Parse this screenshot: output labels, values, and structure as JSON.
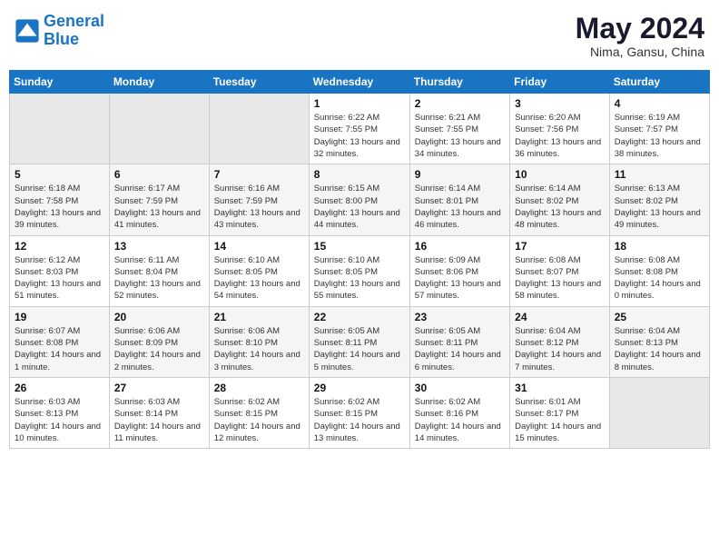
{
  "header": {
    "logo_line1": "General",
    "logo_line2": "Blue",
    "month_year": "May 2024",
    "location": "Nima, Gansu, China"
  },
  "days_of_week": [
    "Sunday",
    "Monday",
    "Tuesday",
    "Wednesday",
    "Thursday",
    "Friday",
    "Saturday"
  ],
  "weeks": [
    [
      {
        "day": "",
        "empty": true
      },
      {
        "day": "",
        "empty": true
      },
      {
        "day": "",
        "empty": true
      },
      {
        "day": "1",
        "sunrise": "6:22 AM",
        "sunset": "7:55 PM",
        "daylight": "13 hours and 32 minutes."
      },
      {
        "day": "2",
        "sunrise": "6:21 AM",
        "sunset": "7:55 PM",
        "daylight": "13 hours and 34 minutes."
      },
      {
        "day": "3",
        "sunrise": "6:20 AM",
        "sunset": "7:56 PM",
        "daylight": "13 hours and 36 minutes."
      },
      {
        "day": "4",
        "sunrise": "6:19 AM",
        "sunset": "7:57 PM",
        "daylight": "13 hours and 38 minutes."
      }
    ],
    [
      {
        "day": "5",
        "sunrise": "6:18 AM",
        "sunset": "7:58 PM",
        "daylight": "13 hours and 39 minutes."
      },
      {
        "day": "6",
        "sunrise": "6:17 AM",
        "sunset": "7:59 PM",
        "daylight": "13 hours and 41 minutes."
      },
      {
        "day": "7",
        "sunrise": "6:16 AM",
        "sunset": "7:59 PM",
        "daylight": "13 hours and 43 minutes."
      },
      {
        "day": "8",
        "sunrise": "6:15 AM",
        "sunset": "8:00 PM",
        "daylight": "13 hours and 44 minutes."
      },
      {
        "day": "9",
        "sunrise": "6:14 AM",
        "sunset": "8:01 PM",
        "daylight": "13 hours and 46 minutes."
      },
      {
        "day": "10",
        "sunrise": "6:14 AM",
        "sunset": "8:02 PM",
        "daylight": "13 hours and 48 minutes."
      },
      {
        "day": "11",
        "sunrise": "6:13 AM",
        "sunset": "8:02 PM",
        "daylight": "13 hours and 49 minutes."
      }
    ],
    [
      {
        "day": "12",
        "sunrise": "6:12 AM",
        "sunset": "8:03 PM",
        "daylight": "13 hours and 51 minutes."
      },
      {
        "day": "13",
        "sunrise": "6:11 AM",
        "sunset": "8:04 PM",
        "daylight": "13 hours and 52 minutes."
      },
      {
        "day": "14",
        "sunrise": "6:10 AM",
        "sunset": "8:05 PM",
        "daylight": "13 hours and 54 minutes."
      },
      {
        "day": "15",
        "sunrise": "6:10 AM",
        "sunset": "8:05 PM",
        "daylight": "13 hours and 55 minutes."
      },
      {
        "day": "16",
        "sunrise": "6:09 AM",
        "sunset": "8:06 PM",
        "daylight": "13 hours and 57 minutes."
      },
      {
        "day": "17",
        "sunrise": "6:08 AM",
        "sunset": "8:07 PM",
        "daylight": "13 hours and 58 minutes."
      },
      {
        "day": "18",
        "sunrise": "6:08 AM",
        "sunset": "8:08 PM",
        "daylight": "14 hours and 0 minutes."
      }
    ],
    [
      {
        "day": "19",
        "sunrise": "6:07 AM",
        "sunset": "8:08 PM",
        "daylight": "14 hours and 1 minute."
      },
      {
        "day": "20",
        "sunrise": "6:06 AM",
        "sunset": "8:09 PM",
        "daylight": "14 hours and 2 minutes."
      },
      {
        "day": "21",
        "sunrise": "6:06 AM",
        "sunset": "8:10 PM",
        "daylight": "14 hours and 3 minutes."
      },
      {
        "day": "22",
        "sunrise": "6:05 AM",
        "sunset": "8:11 PM",
        "daylight": "14 hours and 5 minutes."
      },
      {
        "day": "23",
        "sunrise": "6:05 AM",
        "sunset": "8:11 PM",
        "daylight": "14 hours and 6 minutes."
      },
      {
        "day": "24",
        "sunrise": "6:04 AM",
        "sunset": "8:12 PM",
        "daylight": "14 hours and 7 minutes."
      },
      {
        "day": "25",
        "sunrise": "6:04 AM",
        "sunset": "8:13 PM",
        "daylight": "14 hours and 8 minutes."
      }
    ],
    [
      {
        "day": "26",
        "sunrise": "6:03 AM",
        "sunset": "8:13 PM",
        "daylight": "14 hours and 10 minutes."
      },
      {
        "day": "27",
        "sunrise": "6:03 AM",
        "sunset": "8:14 PM",
        "daylight": "14 hours and 11 minutes."
      },
      {
        "day": "28",
        "sunrise": "6:02 AM",
        "sunset": "8:15 PM",
        "daylight": "14 hours and 12 minutes."
      },
      {
        "day": "29",
        "sunrise": "6:02 AM",
        "sunset": "8:15 PM",
        "daylight": "14 hours and 13 minutes."
      },
      {
        "day": "30",
        "sunrise": "6:02 AM",
        "sunset": "8:16 PM",
        "daylight": "14 hours and 14 minutes."
      },
      {
        "day": "31",
        "sunrise": "6:01 AM",
        "sunset": "8:17 PM",
        "daylight": "14 hours and 15 minutes."
      },
      {
        "day": "",
        "empty": true
      }
    ]
  ]
}
